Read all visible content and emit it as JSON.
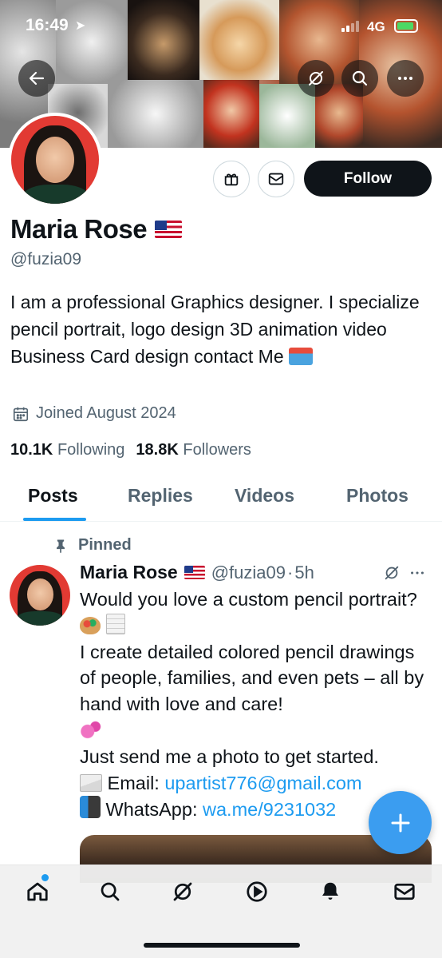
{
  "status_bar": {
    "time": "16:49",
    "network": "4G"
  },
  "profile": {
    "name": "Maria Rose",
    "handle": "@fuzia09",
    "bio": "I am a professional Graphics designer. I specialize pencil portrait, logo design 3D animation video Business Card design contact Me",
    "joined": "Joined August 2024",
    "following_count": "10.1K",
    "following_label": "Following",
    "followers_count": "18.8K",
    "followers_label": "Followers",
    "follow_button": "Follow"
  },
  "tabs": [
    {
      "label": "Posts",
      "active": true
    },
    {
      "label": "Replies",
      "active": false
    },
    {
      "label": "Videos",
      "active": false
    },
    {
      "label": "Photos",
      "active": false
    }
  ],
  "post": {
    "pinned_label": "Pinned",
    "author": "Maria Rose",
    "handle": "@fuzia09",
    "separator": "·",
    "time": "5h",
    "line1": "Would you love a custom pencil portrait?",
    "line2": "I create detailed colored pencil drawings of people, families, and even pets – all by hand with love and care!",
    "line3": "Just send me a photo to get started.",
    "email_label": "Email:",
    "email_link": "upartist776@gmail.com",
    "whatsapp_label": "WhatsApp:",
    "whatsapp_link": "wa.me/9231032"
  },
  "colors": {
    "accent": "#1d9bf0",
    "text": "#0f1419",
    "muted": "#536471",
    "follow_bg": "#0f1419"
  },
  "icons": {
    "header": [
      "back-arrow-icon",
      "grok-icon",
      "search-icon",
      "more-icon"
    ],
    "actions": [
      "gift-icon",
      "mail-icon"
    ],
    "bottom_nav": [
      "home-icon",
      "search-icon",
      "grok-icon",
      "play-icon",
      "bell-icon",
      "mail-icon"
    ]
  }
}
